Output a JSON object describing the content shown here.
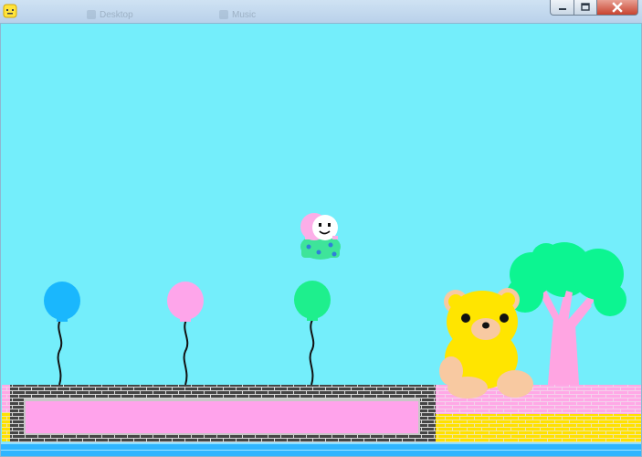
{
  "window": {
    "desktop_behind": [
      "Desktop",
      "Music"
    ],
    "controls": {
      "minimize_icon": "minimize-icon",
      "maximize_icon": "maximize-icon",
      "close_icon": "close-icon"
    }
  },
  "colors": {
    "sky": "#74eefb",
    "brick_dark": "#444444",
    "brick_mortar": "#dddddd",
    "platform_pink": "#ffa3eb",
    "wall_pink": "#ffa8e6",
    "wall_yellow": "#ffe100",
    "water": "#2fb5ff",
    "balloon_blue": "#1ab7fd",
    "balloon_pink": "#fea5ea",
    "balloon_green": "#1eef8d",
    "bear_yellow": "#ffe500",
    "bear_tan": "#f8c9a1",
    "tree_green": "#0cf591",
    "tree_trunk": "#ffa5e2",
    "player_pink": "#fcaee8",
    "player_shell": "#3ee49a"
  },
  "scene": {
    "balloons": [
      {
        "name": "balloon-blue",
        "color": "#1ab7fd"
      },
      {
        "name": "balloon-pink",
        "color": "#fea5ea"
      },
      {
        "name": "balloon-green",
        "color": "#1eef8d"
      }
    ],
    "sprites": [
      "player-character",
      "teddy-bear",
      "pink-tree",
      "brick-platform",
      "pink-brick-wall"
    ]
  }
}
